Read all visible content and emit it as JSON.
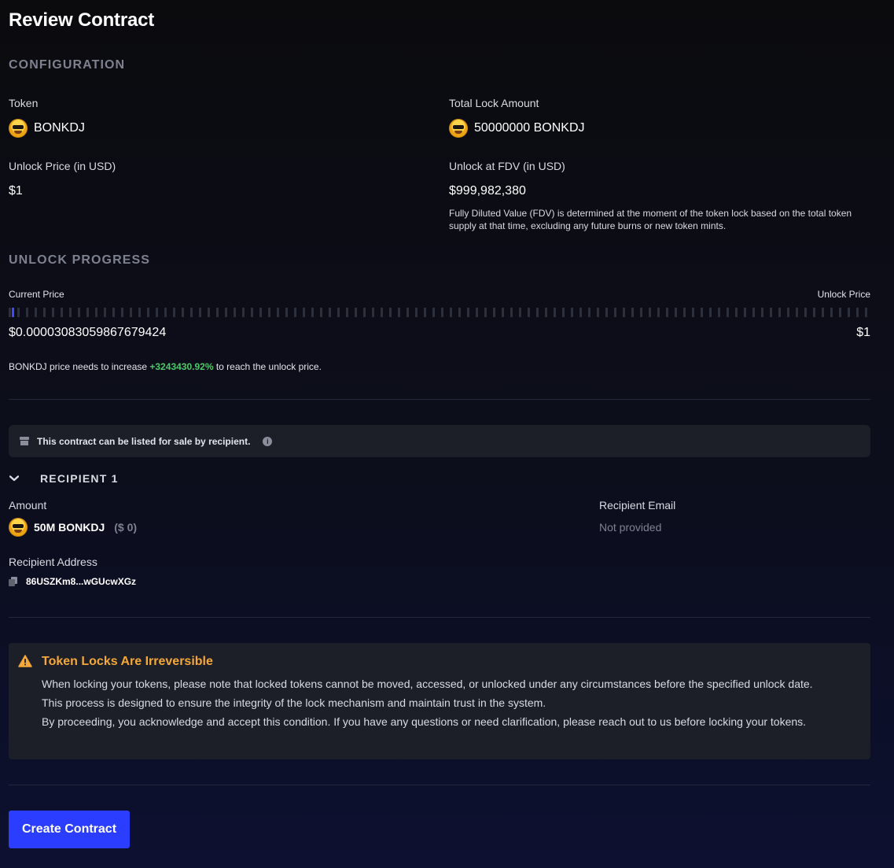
{
  "page": {
    "title": "Review Contract"
  },
  "configuration": {
    "section_title": "CONFIGURATION",
    "token_label": "Token",
    "token_value": "BONKDJ",
    "total_lock_label": "Total Lock Amount",
    "total_lock_value": "50000000 BONKDJ",
    "unlock_price_label": "Unlock Price (in USD)",
    "unlock_price_value": "$1",
    "unlock_fdv_label": "Unlock at FDV (in USD)",
    "unlock_fdv_value": "$999,982,380",
    "fdv_note": "Fully Diluted Value (FDV) is determined at the moment of the token lock based on the total token supply at that time, excluding any future burns or new token mints."
  },
  "unlock_progress": {
    "section_title": "UNLOCK PROGRESS",
    "current_price_label": "Current Price",
    "unlock_price_label": "Unlock Price",
    "current_price_value": "$0.00003083059867679424",
    "unlock_price_value": "$1",
    "progress_fraction": 3e-05,
    "increase_prefix": "BONKDJ price needs to increase ",
    "increase_pct": "+3243430.92%",
    "increase_suffix": " to reach the unlock price.",
    "colors": {
      "filled": "#3d49ff",
      "empty": "#2c2f3c",
      "increase": "#4cc86a"
    }
  },
  "sale_notice": {
    "text": "This contract can be listed for sale by recipient.",
    "icon": "store-icon",
    "info_icon": "info-icon",
    "info_glyph": "i"
  },
  "recipient": {
    "heading": "RECIPIENT 1",
    "amount_label": "Amount",
    "amount_value": "50M BONKDJ",
    "amount_usd": "($ 0)",
    "email_label": "Recipient Email",
    "email_value": "Not provided",
    "address_label": "Recipient Address",
    "address_value": "86USZKm8...wGUcwXGz"
  },
  "warning": {
    "title": "Token Locks Are Irreversible",
    "line1": "When locking your tokens, please note that locked tokens cannot be moved, accessed, or unlocked under any circumstances before the specified unlock date. This process is designed to ensure the integrity of the lock mechanism and maintain trust in the system.",
    "line2": "By proceeding, you acknowledge and accept this condition. If you have any questions or need clarification, please reach out to us before locking your tokens.",
    "color": "#f5a83a"
  },
  "actions": {
    "create_label": "Create Contract",
    "accent": "#2b3dff"
  }
}
